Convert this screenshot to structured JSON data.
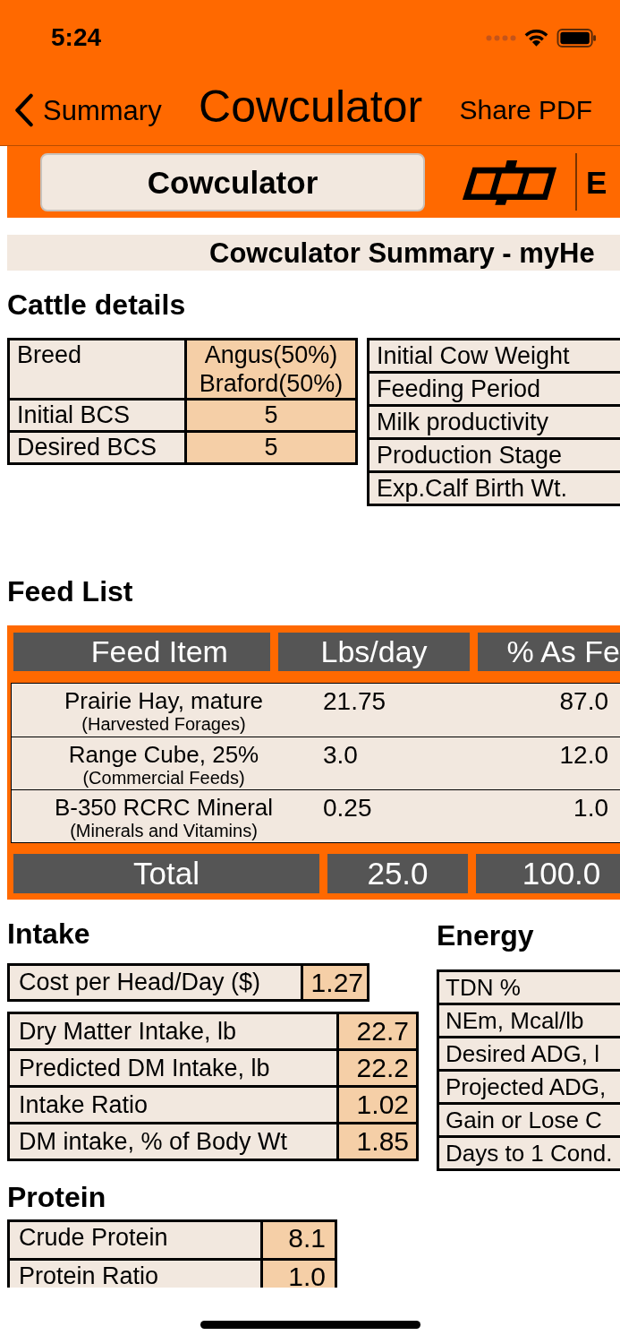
{
  "status_bar": {
    "time": "5:24"
  },
  "nav_bar": {
    "back_label": "Summary",
    "title": "Cowculator",
    "action": "Share PDF"
  },
  "toolbar": {
    "button": "Cowculator",
    "next_button": "E"
  },
  "report": {
    "title": "Cowculator Summary - myHe"
  },
  "cattle_details": {
    "heading": "Cattle details",
    "left_table": [
      {
        "label": "Breed",
        "value": "Angus(50%) Braford(50%)"
      },
      {
        "label": "Initial BCS",
        "value": "5"
      },
      {
        "label": "Desired BCS",
        "value": "5"
      }
    ],
    "right_table": [
      "Initial Cow Weight",
      "Feeding Period",
      "Milk productivity",
      "Production Stage",
      "Exp.Calf Birth Wt."
    ]
  },
  "feed_list": {
    "heading": "Feed List",
    "columns": [
      "Feed Item",
      "Lbs/day",
      "% As Fe"
    ],
    "rows": [
      {
        "name": "Prairie Hay, mature",
        "category": "(Harvested Forages)",
        "lbs_per_day": "21.75",
        "percent_as_fed": "87.0"
      },
      {
        "name": "Range Cube, 25%",
        "category": "(Commercial Feeds)",
        "lbs_per_day": "3.0",
        "percent_as_fed": "12.0"
      },
      {
        "name": "B-350 RCRC Mineral",
        "category": "(Minerals and Vitamins)",
        "lbs_per_day": "0.25",
        "percent_as_fed": "1.0"
      }
    ],
    "total": {
      "label": "Total",
      "lbs_per_day": "25.0",
      "percent_as_fed": "100.0"
    }
  },
  "intake": {
    "heading": "Intake",
    "cost": {
      "label": "Cost per Head/Day ($)",
      "value": "1.27"
    },
    "rows": [
      {
        "label": "Dry Matter Intake, lb",
        "value": "22.7"
      },
      {
        "label": "Predicted DM Intake, lb",
        "value": "22.2"
      },
      {
        "label": "Intake Ratio",
        "value": "1.02"
      },
      {
        "label": "DM intake, % of Body Wt",
        "value": "1.85"
      }
    ]
  },
  "energy": {
    "heading": "Energy",
    "rows": [
      "TDN %",
      "NEm, Mcal/lb",
      "Desired ADG, l",
      "Projected ADG,",
      "Gain or Lose C",
      "Days to 1 Cond."
    ]
  },
  "protein": {
    "heading": "Protein",
    "rows": [
      {
        "label": "Crude Protein",
        "value": "8.1"
      },
      {
        "label": "Protein Ratio",
        "value": "1.0"
      }
    ]
  }
}
